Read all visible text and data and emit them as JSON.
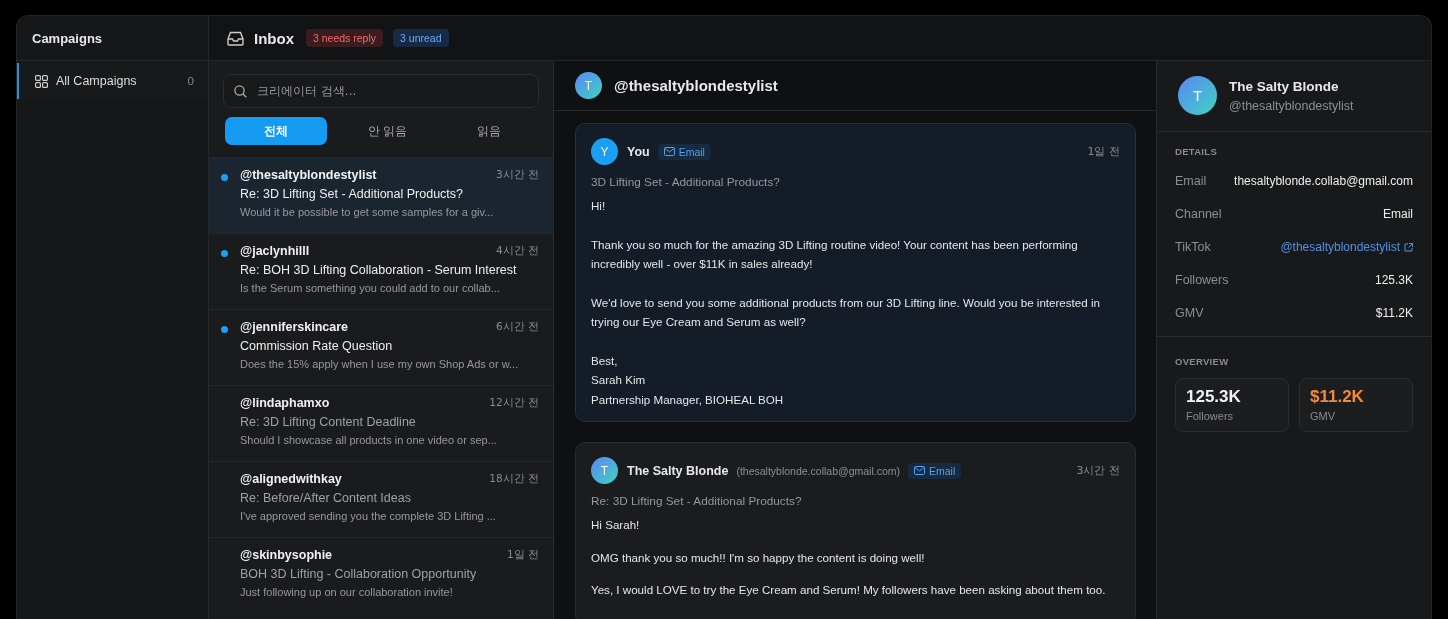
{
  "sidebar": {
    "title": "Campaigns",
    "items": [
      {
        "label": "All Campaigns",
        "count": "0",
        "selected": true
      }
    ]
  },
  "header": {
    "title": "Inbox",
    "badges": [
      {
        "label": "3 needs reply",
        "kind": "warning"
      },
      {
        "label": "3 unread",
        "kind": "info"
      }
    ]
  },
  "inbox": {
    "search": {
      "placeholder": "크리에이터 검색..."
    },
    "filters": [
      {
        "label": "전체",
        "selected": true
      },
      {
        "label": "안 읽음",
        "selected": false
      },
      {
        "label": "읽음",
        "selected": false
      }
    ],
    "threads": [
      {
        "handle": "@thesaltyblondestylist",
        "time": "3시간 전",
        "subject": "Re: 3D Lifting Set - Additional Products?",
        "preview": "Would it be possible to get some samples for a giv...",
        "unread": true,
        "selected": true
      },
      {
        "handle": "@jaclynhilll",
        "time": "4시간 전",
        "subject": "Re: BOH 3D Lifting Collaboration - Serum Interest",
        "preview": "Is the Serum something you could add to our collab...",
        "unread": true,
        "selected": false
      },
      {
        "handle": "@jenniferskincare",
        "time": "6시간 전",
        "subject": "Commission Rate Question",
        "preview": "Does the 15% apply when I use my own Shop Ads or w...",
        "unread": true,
        "selected": false
      },
      {
        "handle": "@lindaphamxo",
        "time": "12시간 전",
        "subject": "Re: 3D Lifting Content Deadline",
        "preview": "Should I showcase all products in one video or sep...",
        "unread": false,
        "selected": false
      },
      {
        "handle": "@alignedwithkay",
        "time": "18시간 전",
        "subject": "Re: Before/After Content Ideas",
        "preview": "I've approved sending you the complete 3D Lifting ...",
        "unread": false,
        "selected": false
      },
      {
        "handle": "@skinbysophie",
        "time": "1일 전",
        "subject": "BOH 3D Lifting - Collaboration Opportunity",
        "preview": "Just following up on our collaboration invite!",
        "unread": false,
        "selected": false
      }
    ]
  },
  "conversation": {
    "avatar": "T",
    "handle": "@thesaltyblondestylist",
    "messages": [
      {
        "kind": "outgoing",
        "avatar": "Y",
        "sender": "You",
        "channel": "Email",
        "time": "1일 전",
        "subject": "3D Lifting Set - Additional Products?",
        "paragraphs": [
          "Hi!",
          "Thank you so much for the amazing 3D Lifting routine video! Your content has been performing incredibly well - over $11K in sales already!",
          "We'd love to send you some additional products from our 3D Lifting line. Would you be interested in trying our Eye Cream and Serum as well?",
          "Best,\nSarah Kim\nPartnership Manager, BIOHEAL BOH"
        ]
      },
      {
        "kind": "incoming",
        "avatar": "T",
        "sender": "The Salty Blonde",
        "email": "(thesaltyblonde.collab@gmail.com)",
        "channel": "Email",
        "time": "3시간 전",
        "subject": "Re: 3D Lifting Set - Additional Products?",
        "paragraphs": [
          "Hi Sarah!",
          "OMG thank you so much!! I'm so happy the content is doing well!",
          "Yes, I would LOVE to try the Eye Cream and Serum! My followers have been asking about them too."
        ]
      }
    ]
  },
  "profile": {
    "avatar": "T",
    "name": "The Salty Blonde",
    "handle": "@thesaltyblondestylist",
    "details_title": "DETAILS",
    "details": [
      {
        "label": "Email",
        "value": "thesaltyblonde.collab@gmail.com",
        "kind": "text"
      },
      {
        "label": "Channel",
        "value": "Email",
        "kind": "text"
      },
      {
        "label": "TikTok",
        "value": "@thesaltyblondestylist",
        "kind": "link"
      },
      {
        "label": "Followers",
        "value": "125.3K",
        "kind": "text"
      },
      {
        "label": "GMV",
        "value": "$11.2K",
        "kind": "text"
      }
    ],
    "overview_title": "OVERVIEW",
    "stats": [
      {
        "value": "125.3K",
        "label": "Followers",
        "kind": "plain"
      },
      {
        "value": "$11.2K",
        "label": "GMV",
        "kind": "highlight"
      }
    ]
  }
}
